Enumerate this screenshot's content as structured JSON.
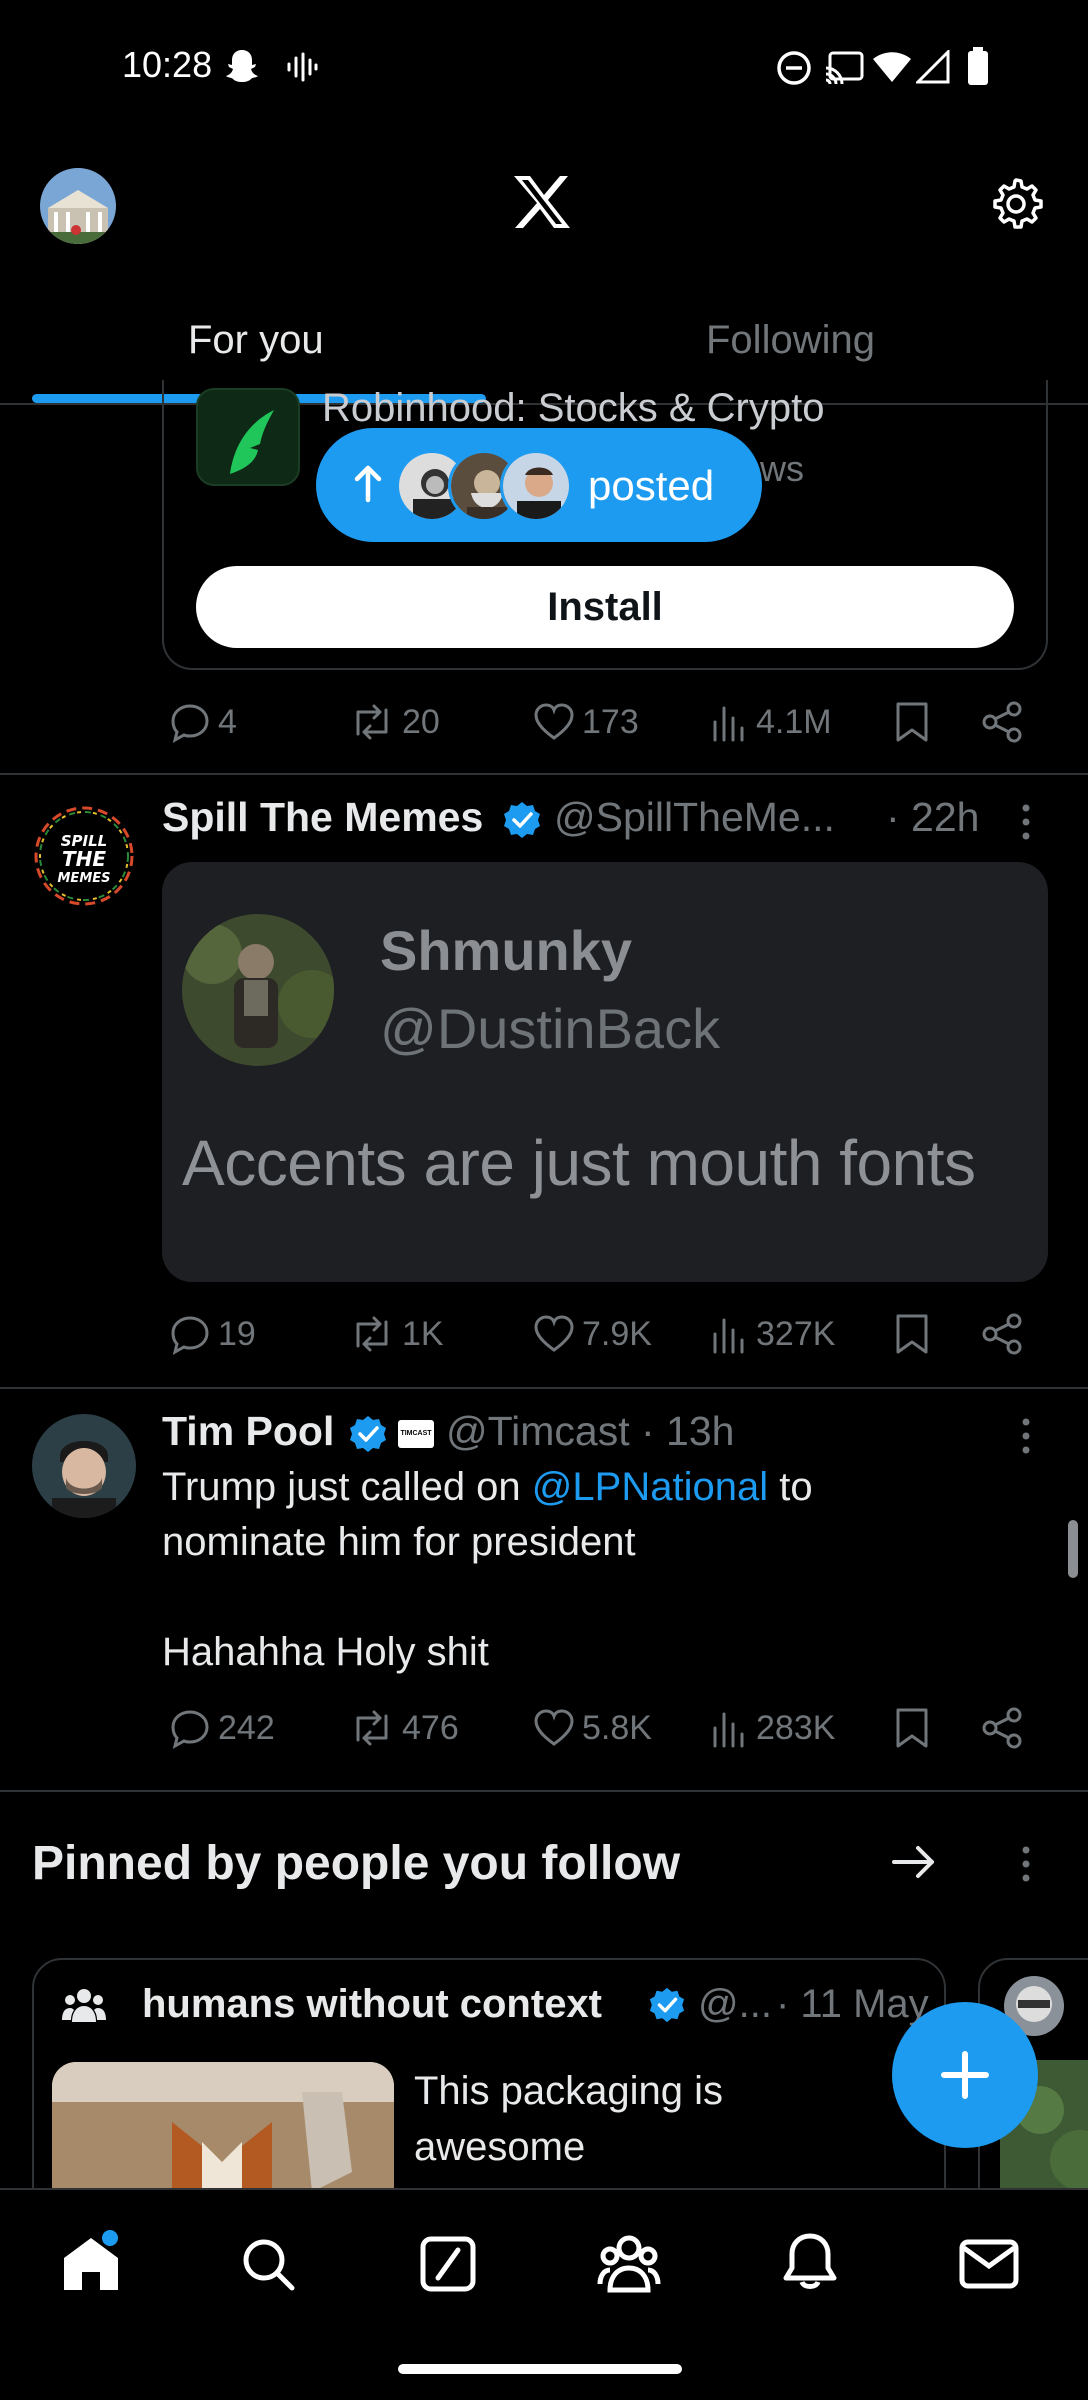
{
  "status_bar": {
    "time": "10:28",
    "icons": [
      "snapchat-icon",
      "voice-icon",
      "dnd-icon",
      "cast-icon",
      "wifi-icon",
      "signal-icon",
      "battery-icon"
    ]
  },
  "header": {
    "logo": "x-logo-icon",
    "tabs": [
      {
        "label": "For you",
        "active": true
      },
      {
        "label": "Following",
        "active": false
      }
    ]
  },
  "ad": {
    "app_title": "Robinhood: Stocks & Crypto",
    "subtitle_fragment": "ws",
    "install_label": "Install",
    "actions": {
      "replies": "4",
      "reposts": "20",
      "likes": "173",
      "views": "4.1M"
    }
  },
  "posted_pill": {
    "label": "posted"
  },
  "tweets": [
    {
      "name": "Spill The Memes",
      "handle": "@SpillTheMe...",
      "time": "· 22h",
      "avatar_text": "SPILL THE MEMES",
      "media": {
        "quoted_name": "Shmunky",
        "quoted_handle": "@DustinBack",
        "quoted_text": "Accents are just mouth fonts"
      },
      "actions": {
        "replies": "19",
        "reposts": "1K",
        "likes": "7.9K",
        "views": "327K"
      }
    },
    {
      "name": "Tim Pool",
      "badge": "TIMCAST",
      "handle": "@Timcast · 13h",
      "text_before": "Trump just called on ",
      "mention": "@LPNational",
      "text_after": " to",
      "line2": "nominate him for president",
      "line3": "Hahahha Holy shit",
      "actions": {
        "replies": "242",
        "reposts": "476",
        "likes": "5.8K",
        "views": "283K"
      }
    }
  ],
  "pinned": {
    "title": "Pinned by people you follow",
    "card": {
      "name": "humans without context",
      "handle": "@...",
      "time": "· 11 May",
      "text_line1": "This packaging is",
      "text_line2": "awesome"
    }
  },
  "colors": {
    "accent": "#1d9bf0",
    "background": "#000000",
    "secondary_text": "#71767b"
  },
  "bottom_nav": [
    "home-icon",
    "search-icon",
    "grok-icon",
    "communities-icon",
    "notifications-icon",
    "messages-icon"
  ]
}
